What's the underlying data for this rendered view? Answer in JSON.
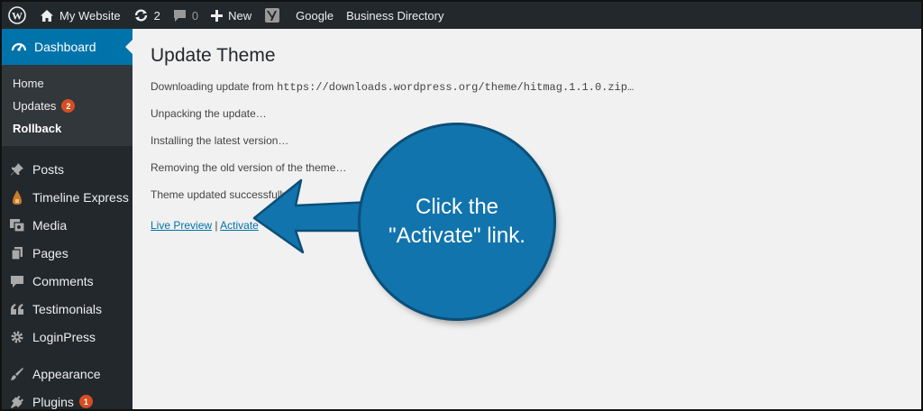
{
  "adminbar": {
    "site_name": "My Website",
    "updates_count": "2",
    "comments_count": "0",
    "new_label": "New",
    "google_label": "Google",
    "directory_label": "Business Directory"
  },
  "sidebar": {
    "dashboard_label": "Dashboard",
    "submenu": [
      {
        "label": "Home"
      },
      {
        "label": "Updates",
        "badge": "2"
      },
      {
        "label": "Rollback"
      }
    ],
    "items": [
      {
        "label": "Posts",
        "icon": "pin-icon"
      },
      {
        "label": "Timeline Express",
        "icon": "timeline-icon"
      },
      {
        "label": "Media",
        "icon": "media-icon"
      },
      {
        "label": "Pages",
        "icon": "pages-icon"
      },
      {
        "label": "Comments",
        "icon": "comment-icon"
      },
      {
        "label": "Testimonials",
        "icon": "quote-icon"
      },
      {
        "label": "LoginPress",
        "icon": "gear-icon"
      },
      {
        "label": "Appearance",
        "icon": "brush-icon"
      },
      {
        "label": "Plugins",
        "icon": "plug-icon",
        "badge": "1"
      }
    ]
  },
  "main": {
    "title": "Update Theme",
    "download_prefix": "Downloading update from ",
    "download_url": "https://downloads.wordpress.org/theme/hitmag.1.1.0.zip…",
    "log": [
      "Unpacking the update…",
      "Installing the latest version…",
      "Removing the old version of the theme…",
      "Theme updated successfully."
    ],
    "live_preview_label": "Live Preview",
    "separator": " | ",
    "activate_label": "Activate"
  },
  "annotation": {
    "line1": "Click the",
    "line2": "\"Activate\" link."
  },
  "colors": {
    "admin_bg": "#23282d",
    "accent": "#0073aa",
    "badge": "#d54e21",
    "callout": "#1274ad"
  }
}
